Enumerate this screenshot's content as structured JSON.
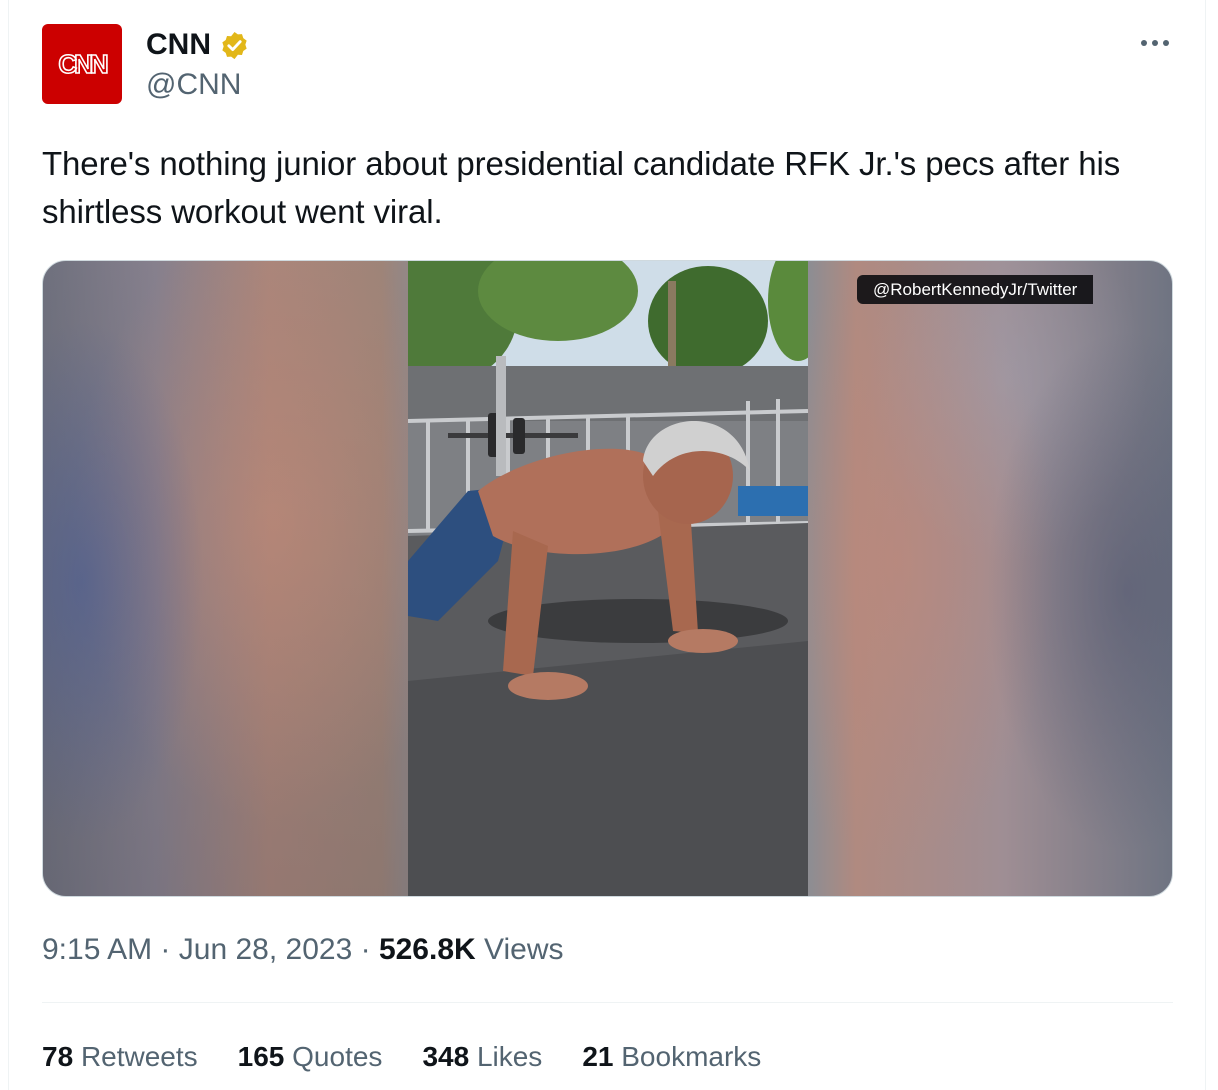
{
  "author": {
    "display_name": "CNN",
    "handle": "@CNN",
    "avatar_text": "CNN",
    "verified": true,
    "verified_color": "#e2b719",
    "brand_color": "#cc0000"
  },
  "tweet": {
    "text": "There's nothing junior about presidential candidate RFK Jr.'s pecs after his shirtless workout went viral."
  },
  "media": {
    "watermark": "@RobertKennedyJr/Twitter"
  },
  "meta": {
    "time": "9:15 AM",
    "separator": "·",
    "date": "Jun 28, 2023",
    "views_count": "526.8K",
    "views_label": "Views"
  },
  "stats": [
    {
      "count": "78",
      "label": "Retweets"
    },
    {
      "count": "165",
      "label": "Quotes"
    },
    {
      "count": "348",
      "label": "Likes"
    },
    {
      "count": "21",
      "label": "Bookmarks"
    }
  ],
  "icons": {
    "more": "more-icon",
    "verified": "verified-badge-icon"
  }
}
